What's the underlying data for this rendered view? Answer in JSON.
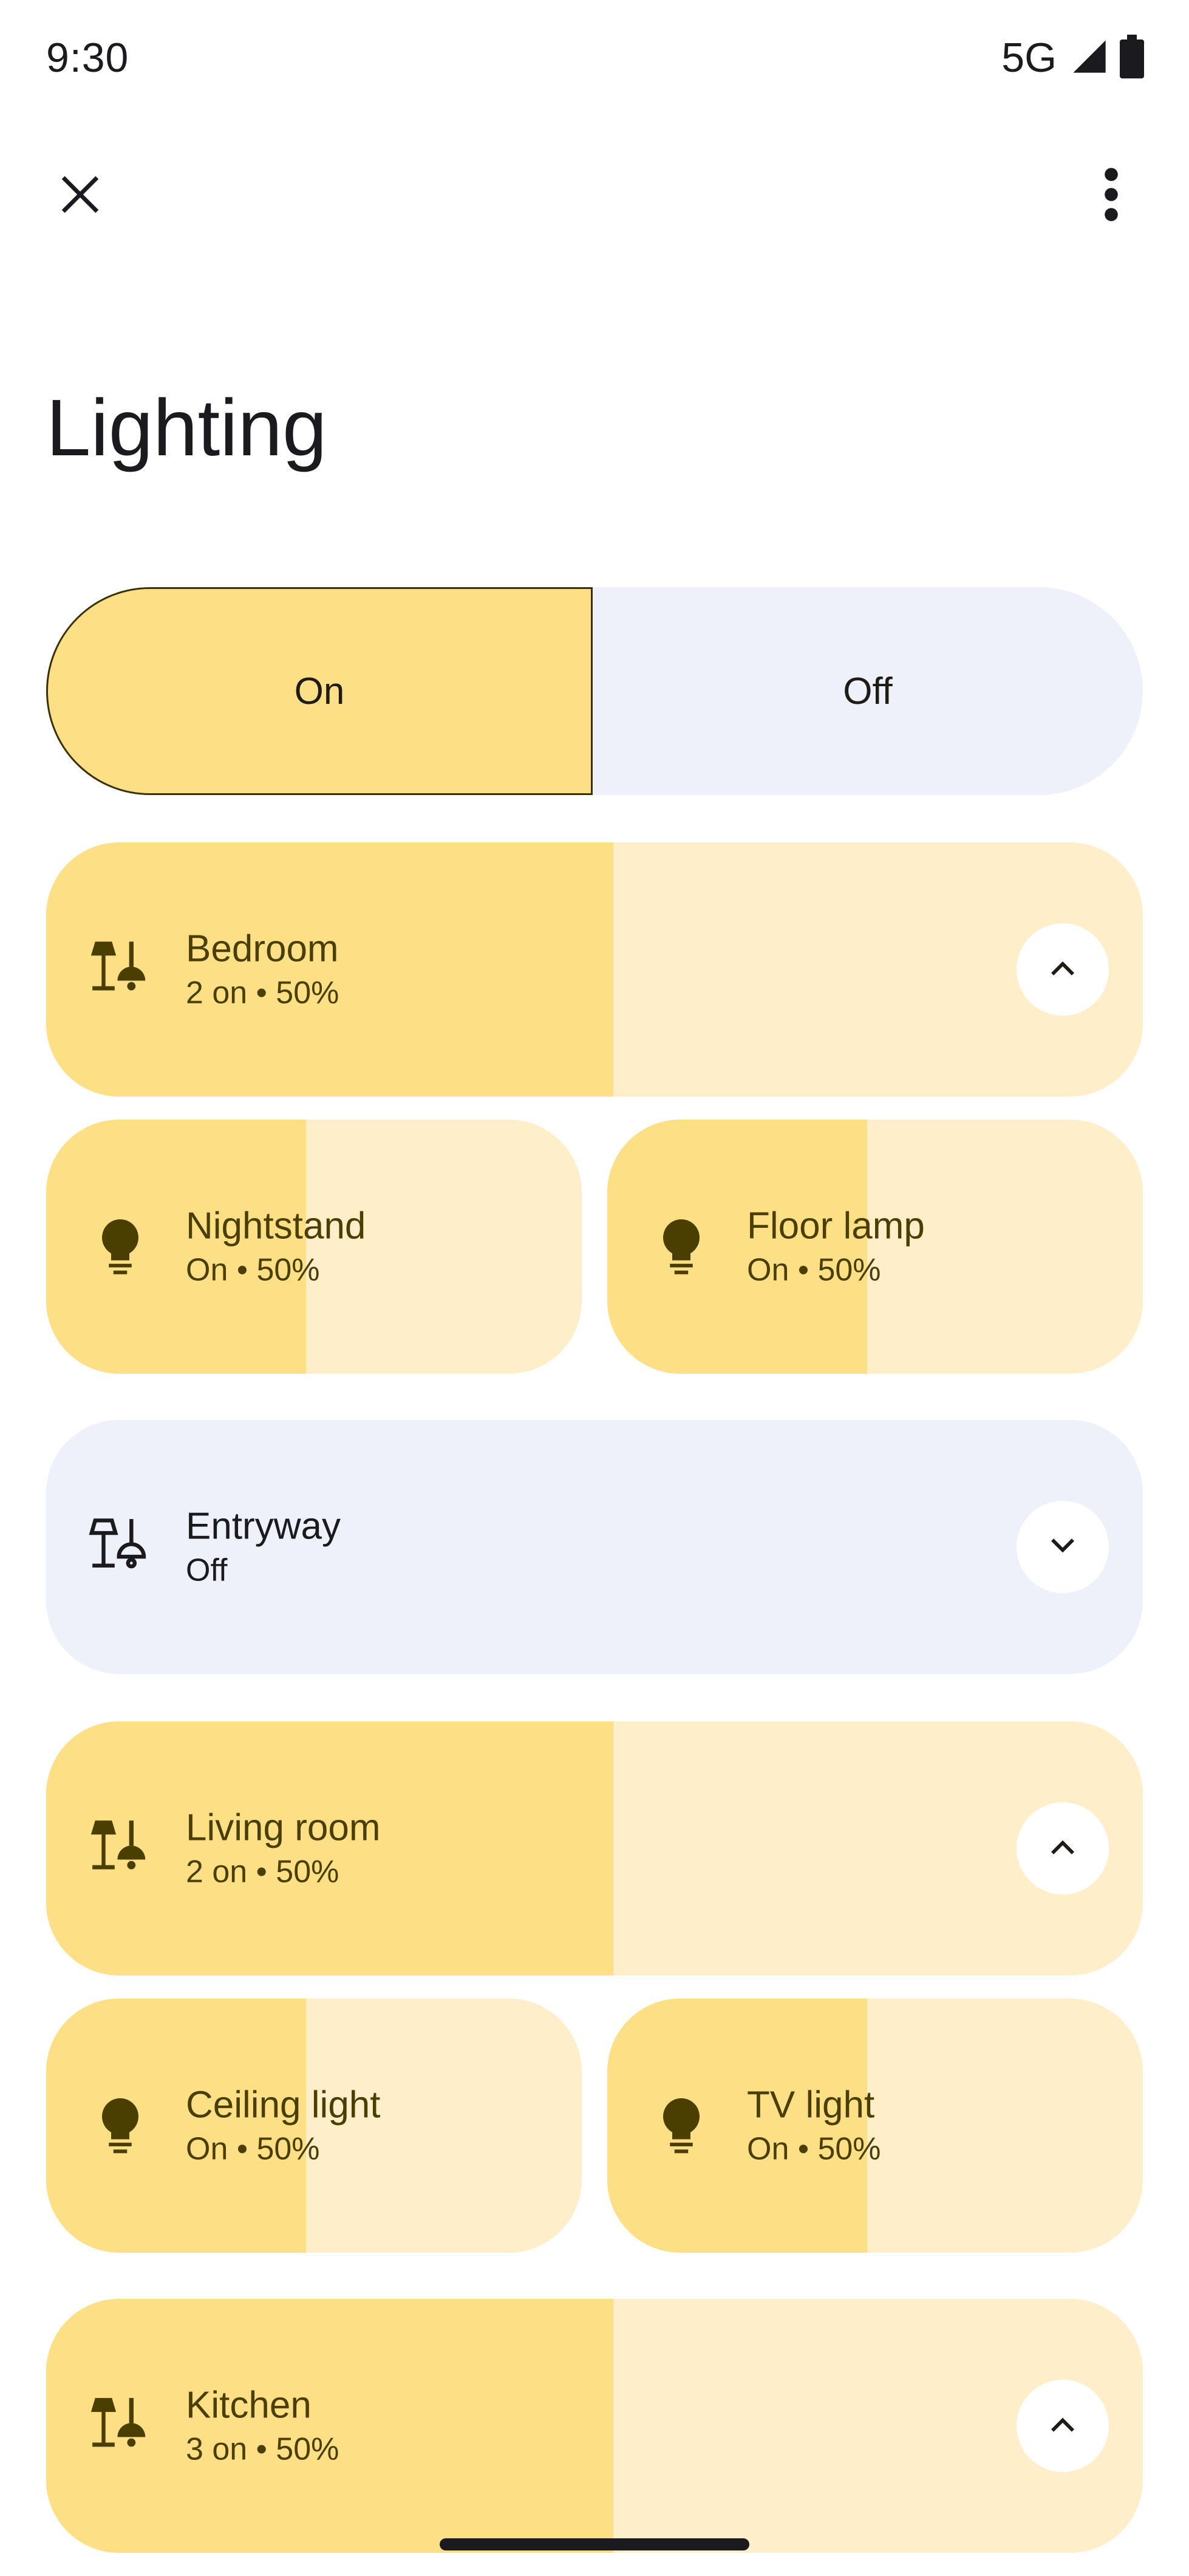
{
  "status_bar": {
    "time": "9:30",
    "network": "5G"
  },
  "header": {
    "title": "Lighting"
  },
  "toggle": {
    "on_label": "On",
    "off_label": "Off",
    "selected": "On"
  },
  "groups": [
    {
      "name": "Bedroom",
      "status": "2 on • 50%",
      "expanded": true,
      "level": 0.5,
      "devices": [
        {
          "name": "Nightstand",
          "status": "On • 50%",
          "level": 0.5
        },
        {
          "name": "Floor lamp",
          "status": "On • 50%",
          "level": 0.5
        }
      ]
    },
    {
      "name": "Entryway",
      "status": "Off",
      "expanded": false
    },
    {
      "name": "Living room",
      "status": "2 on • 50%",
      "expanded": true,
      "level": 0.5,
      "devices": [
        {
          "name": "Ceiling light",
          "status": "On • 50%",
          "level": 0.5
        },
        {
          "name": "TV light",
          "status": "On • 50%",
          "level": 0.5
        }
      ]
    },
    {
      "name": "Kitchen",
      "status": "3 on • 50%",
      "expanded": true,
      "level": 0.5
    }
  ],
  "colors": {
    "on_fill": "#fde085",
    "on_track": "#feefca",
    "off_bg": "#eef1fa",
    "on_text": "#4a3f00"
  },
  "icons": {
    "group": "lamps-icon",
    "device": "lightbulb-icon",
    "expanded": "chevron-up-icon",
    "collapsed": "chevron-down-icon"
  }
}
